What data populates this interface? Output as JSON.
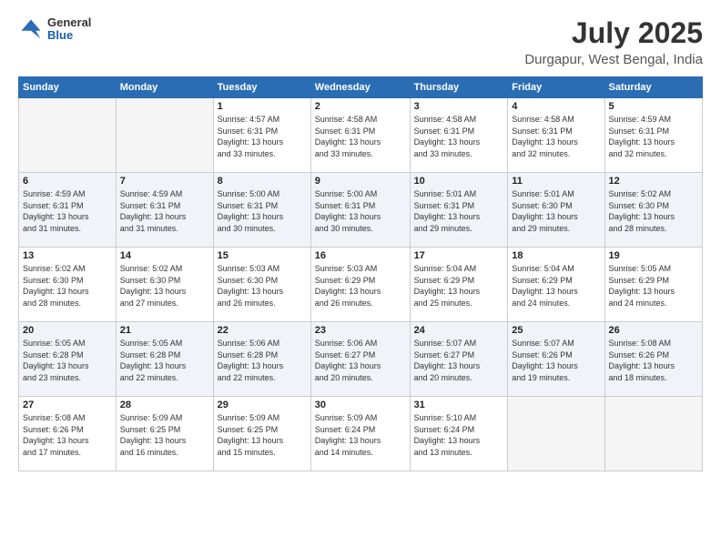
{
  "header": {
    "logo": {
      "general": "General",
      "blue": "Blue"
    },
    "title": "July 2025",
    "subtitle": "Durgapur, West Bengal, India"
  },
  "days_of_week": [
    "Sunday",
    "Monday",
    "Tuesday",
    "Wednesday",
    "Thursday",
    "Friday",
    "Saturday"
  ],
  "weeks": [
    {
      "alt": false,
      "days": [
        {
          "num": "",
          "info": ""
        },
        {
          "num": "",
          "info": ""
        },
        {
          "num": "1",
          "info": "Sunrise: 4:57 AM\nSunset: 6:31 PM\nDaylight: 13 hours\nand 33 minutes."
        },
        {
          "num": "2",
          "info": "Sunrise: 4:58 AM\nSunset: 6:31 PM\nDaylight: 13 hours\nand 33 minutes."
        },
        {
          "num": "3",
          "info": "Sunrise: 4:58 AM\nSunset: 6:31 PM\nDaylight: 13 hours\nand 33 minutes."
        },
        {
          "num": "4",
          "info": "Sunrise: 4:58 AM\nSunset: 6:31 PM\nDaylight: 13 hours\nand 32 minutes."
        },
        {
          "num": "5",
          "info": "Sunrise: 4:59 AM\nSunset: 6:31 PM\nDaylight: 13 hours\nand 32 minutes."
        }
      ]
    },
    {
      "alt": true,
      "days": [
        {
          "num": "6",
          "info": "Sunrise: 4:59 AM\nSunset: 6:31 PM\nDaylight: 13 hours\nand 31 minutes."
        },
        {
          "num": "7",
          "info": "Sunrise: 4:59 AM\nSunset: 6:31 PM\nDaylight: 13 hours\nand 31 minutes."
        },
        {
          "num": "8",
          "info": "Sunrise: 5:00 AM\nSunset: 6:31 PM\nDaylight: 13 hours\nand 30 minutes."
        },
        {
          "num": "9",
          "info": "Sunrise: 5:00 AM\nSunset: 6:31 PM\nDaylight: 13 hours\nand 30 minutes."
        },
        {
          "num": "10",
          "info": "Sunrise: 5:01 AM\nSunset: 6:31 PM\nDaylight: 13 hours\nand 29 minutes."
        },
        {
          "num": "11",
          "info": "Sunrise: 5:01 AM\nSunset: 6:30 PM\nDaylight: 13 hours\nand 29 minutes."
        },
        {
          "num": "12",
          "info": "Sunrise: 5:02 AM\nSunset: 6:30 PM\nDaylight: 13 hours\nand 28 minutes."
        }
      ]
    },
    {
      "alt": false,
      "days": [
        {
          "num": "13",
          "info": "Sunrise: 5:02 AM\nSunset: 6:30 PM\nDaylight: 13 hours\nand 28 minutes."
        },
        {
          "num": "14",
          "info": "Sunrise: 5:02 AM\nSunset: 6:30 PM\nDaylight: 13 hours\nand 27 minutes."
        },
        {
          "num": "15",
          "info": "Sunrise: 5:03 AM\nSunset: 6:30 PM\nDaylight: 13 hours\nand 26 minutes."
        },
        {
          "num": "16",
          "info": "Sunrise: 5:03 AM\nSunset: 6:29 PM\nDaylight: 13 hours\nand 26 minutes."
        },
        {
          "num": "17",
          "info": "Sunrise: 5:04 AM\nSunset: 6:29 PM\nDaylight: 13 hours\nand 25 minutes."
        },
        {
          "num": "18",
          "info": "Sunrise: 5:04 AM\nSunset: 6:29 PM\nDaylight: 13 hours\nand 24 minutes."
        },
        {
          "num": "19",
          "info": "Sunrise: 5:05 AM\nSunset: 6:29 PM\nDaylight: 13 hours\nand 24 minutes."
        }
      ]
    },
    {
      "alt": true,
      "days": [
        {
          "num": "20",
          "info": "Sunrise: 5:05 AM\nSunset: 6:28 PM\nDaylight: 13 hours\nand 23 minutes."
        },
        {
          "num": "21",
          "info": "Sunrise: 5:05 AM\nSunset: 6:28 PM\nDaylight: 13 hours\nand 22 minutes."
        },
        {
          "num": "22",
          "info": "Sunrise: 5:06 AM\nSunset: 6:28 PM\nDaylight: 13 hours\nand 22 minutes."
        },
        {
          "num": "23",
          "info": "Sunrise: 5:06 AM\nSunset: 6:27 PM\nDaylight: 13 hours\nand 20 minutes."
        },
        {
          "num": "24",
          "info": "Sunrise: 5:07 AM\nSunset: 6:27 PM\nDaylight: 13 hours\nand 20 minutes."
        },
        {
          "num": "25",
          "info": "Sunrise: 5:07 AM\nSunset: 6:26 PM\nDaylight: 13 hours\nand 19 minutes."
        },
        {
          "num": "26",
          "info": "Sunrise: 5:08 AM\nSunset: 6:26 PM\nDaylight: 13 hours\nand 18 minutes."
        }
      ]
    },
    {
      "alt": false,
      "days": [
        {
          "num": "27",
          "info": "Sunrise: 5:08 AM\nSunset: 6:26 PM\nDaylight: 13 hours\nand 17 minutes."
        },
        {
          "num": "28",
          "info": "Sunrise: 5:09 AM\nSunset: 6:25 PM\nDaylight: 13 hours\nand 16 minutes."
        },
        {
          "num": "29",
          "info": "Sunrise: 5:09 AM\nSunset: 6:25 PM\nDaylight: 13 hours\nand 15 minutes."
        },
        {
          "num": "30",
          "info": "Sunrise: 5:09 AM\nSunset: 6:24 PM\nDaylight: 13 hours\nand 14 minutes."
        },
        {
          "num": "31",
          "info": "Sunrise: 5:10 AM\nSunset: 6:24 PM\nDaylight: 13 hours\nand 13 minutes."
        },
        {
          "num": "",
          "info": ""
        },
        {
          "num": "",
          "info": ""
        }
      ]
    }
  ]
}
